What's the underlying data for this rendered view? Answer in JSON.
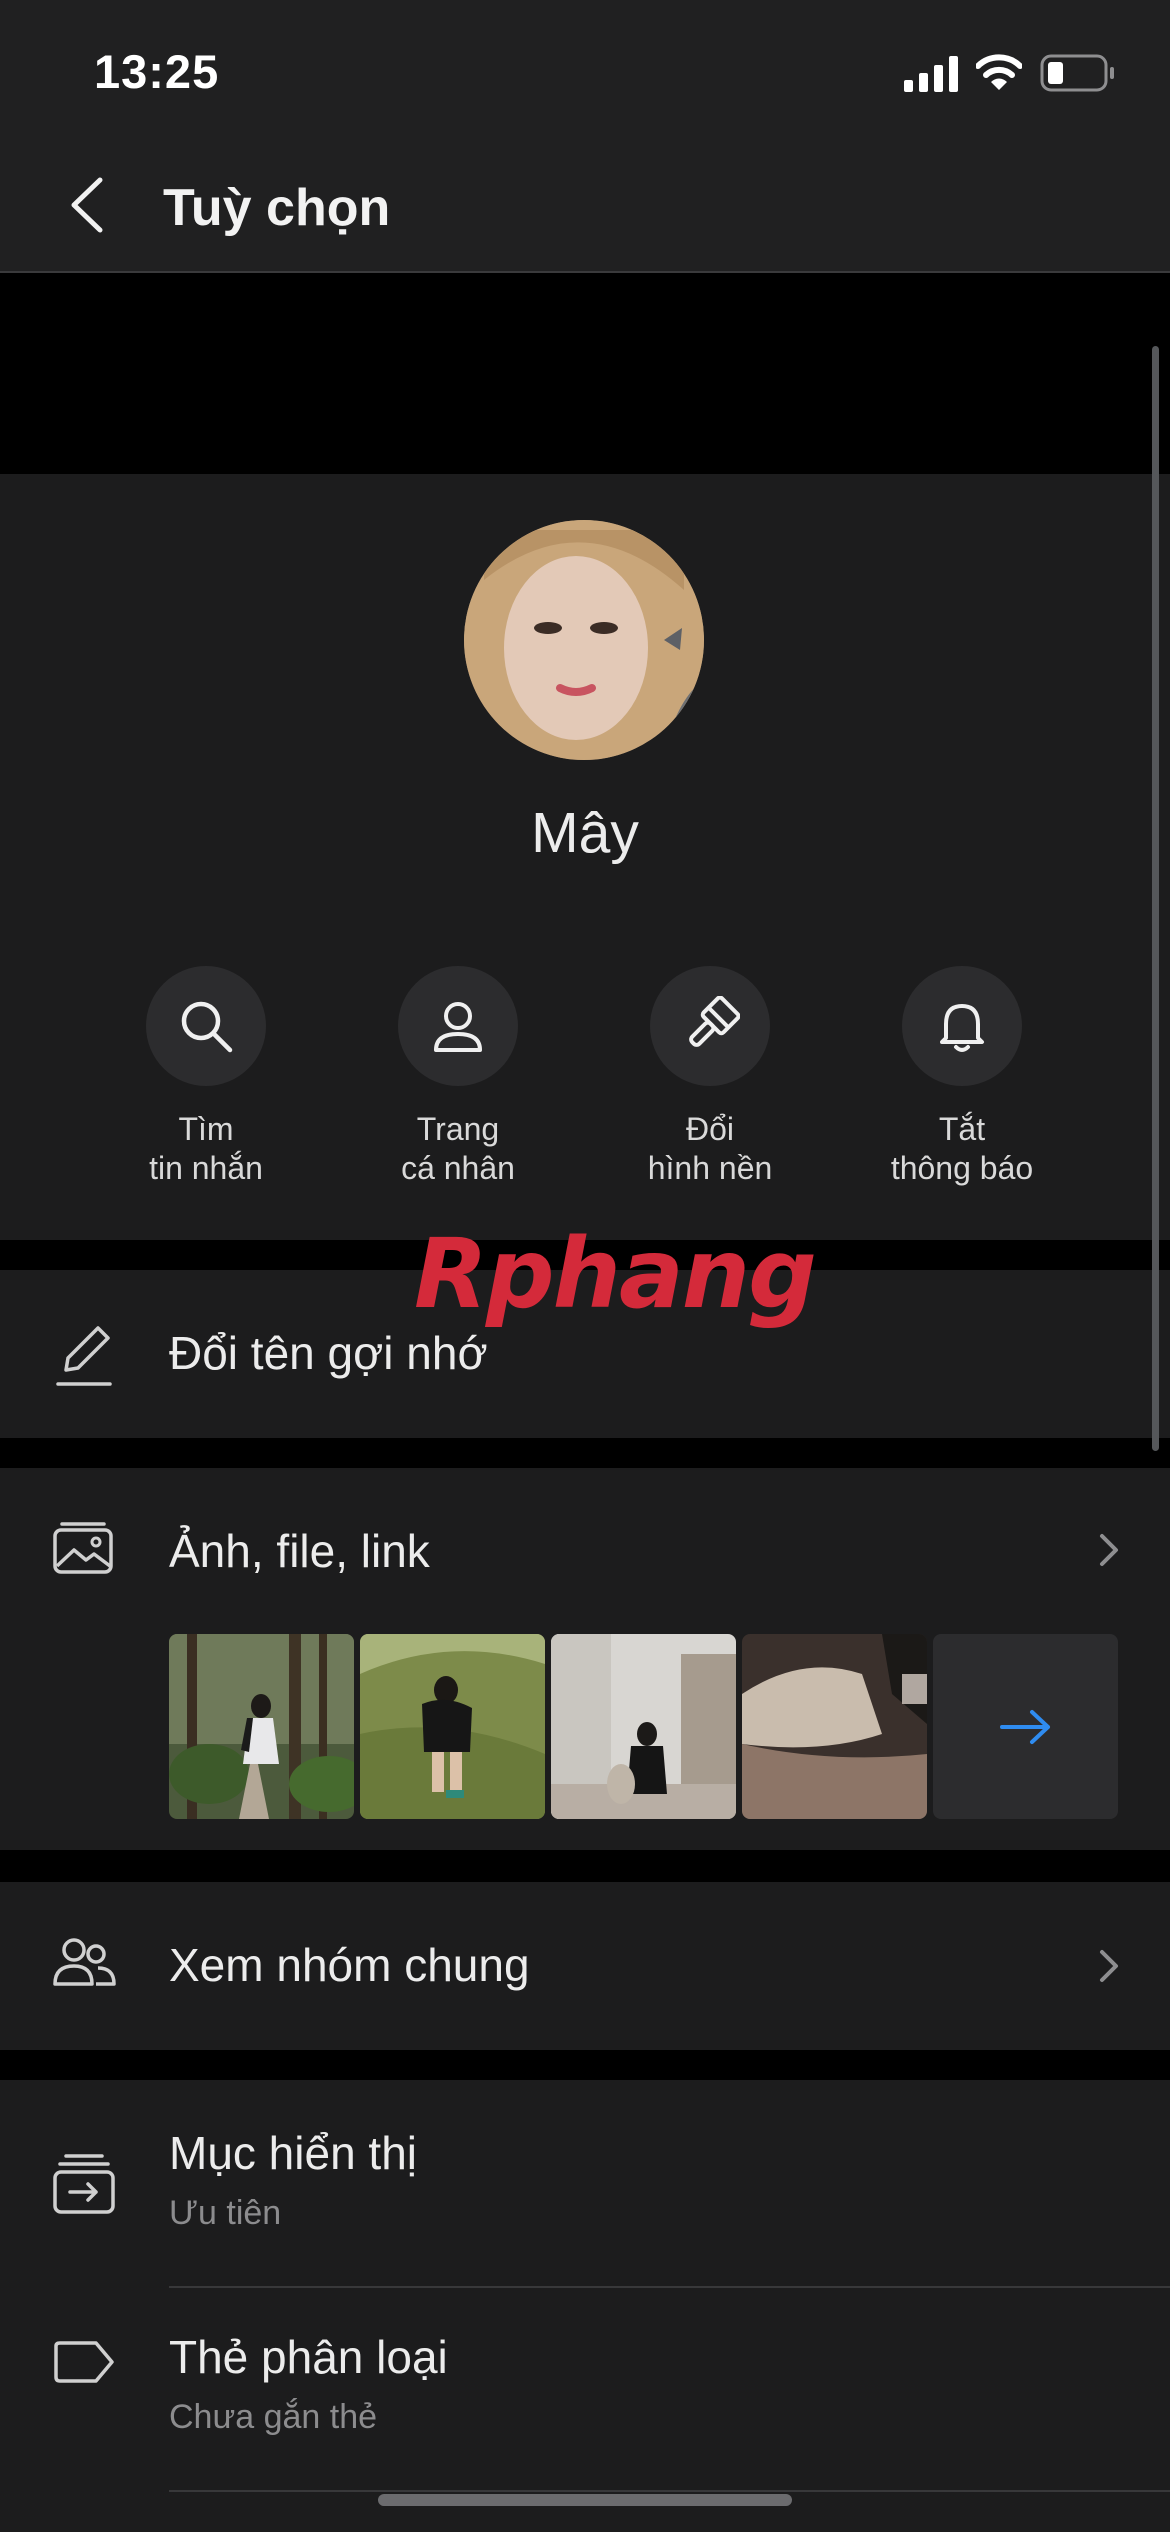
{
  "status_bar": {
    "time": "13:25"
  },
  "header": {
    "title": "Tuỳ chọn"
  },
  "profile": {
    "name": "Mây"
  },
  "actions": [
    {
      "line1": "Tìm",
      "line2": "tin nhắn",
      "icon": "search-icon"
    },
    {
      "line1": "Trang",
      "line2": "cá nhân",
      "icon": "person-icon"
    },
    {
      "line1": "Đổi",
      "line2": "hình nền",
      "icon": "paintbrush-icon"
    },
    {
      "line1": "Tắt",
      "line2": "thông báo",
      "icon": "bell-icon"
    }
  ],
  "watermark": "Rphang",
  "rows": {
    "rename": {
      "title": "Đổi tên gợi nhớ",
      "icon": "pencil-icon"
    },
    "media": {
      "title": "Ảnh, file, link",
      "icon": "media-icon",
      "thumbnail_count": 4
    },
    "groups": {
      "title": "Xem nhóm chung",
      "icon": "group-icon"
    },
    "display": {
      "title": "Mục hiển thị",
      "subtitle": "Ưu tiên",
      "icon": "inbox-icon"
    },
    "tag": {
      "title": "Thẻ phân loại",
      "subtitle": "Chưa gắn thẻ",
      "icon": "tag-icon"
    }
  },
  "colors": {
    "accent": "#2f8cf0",
    "background": "#000000",
    "card": "#1c1c1d",
    "header": "#202021"
  }
}
